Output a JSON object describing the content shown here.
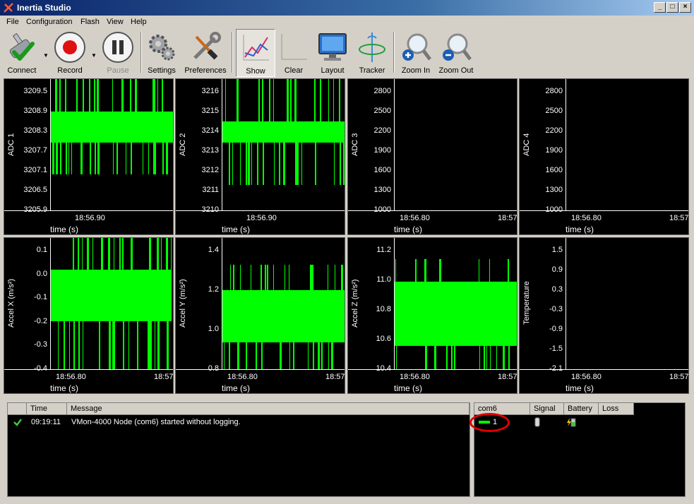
{
  "window": {
    "title": "Inertia Studio"
  },
  "menu": [
    "File",
    "Configuration",
    "Flash",
    "View",
    "Help"
  ],
  "toolbar": {
    "connect": "Connect",
    "record": "Record",
    "pause": "Pause",
    "settings": "Settings",
    "preferences": "Preferences",
    "show": "Show",
    "clear": "Clear",
    "layout": "Layout",
    "tracker": "Tracker",
    "zoom_in": "Zoom In",
    "zoom_out": "Zoom Out"
  },
  "plots": [
    {
      "ylabel": "ADC 1",
      "yticks": [
        "3209.5",
        "3208.9",
        "3208.3",
        "3207.7",
        "3207.1",
        "3206.5",
        "3205.9"
      ],
      "xticks": [
        "18:56.90"
      ],
      "xlabel": "time (s)"
    },
    {
      "ylabel": "ADC 2",
      "yticks": [
        "3216",
        "3215",
        "3214",
        "3213",
        "3212",
        "3211",
        "3210"
      ],
      "xticks": [
        "18:56.90"
      ],
      "xlabel": "time (s)"
    },
    {
      "ylabel": "ADC 3",
      "yticks": [
        "2800",
        "2500",
        "2200",
        "1900",
        "1600",
        "1300",
        "1000"
      ],
      "xticks": [
        "18:56.80",
        "18:57"
      ],
      "xlabel": "time (s)"
    },
    {
      "ylabel": "ADC 4",
      "yticks": [
        "2800",
        "2500",
        "2200",
        "1900",
        "1600",
        "1300",
        "1000"
      ],
      "xticks": [
        "18:56.80",
        "18:57"
      ],
      "xlabel": "time (s)"
    },
    {
      "ylabel": "Accel X (m/s²)",
      "yticks": [
        "0.1",
        "0.0",
        "-0.1",
        "-0.2",
        "-0.3",
        "-0.4"
      ],
      "xticks": [
        "18:56.80",
        "18:57"
      ],
      "xlabel": "time (s)"
    },
    {
      "ylabel": "Accel Y (m/s²)",
      "yticks": [
        "1.4",
        "1.2",
        "1.0",
        "0.8"
      ],
      "xticks": [
        "18:56.80",
        "18:57"
      ],
      "xlabel": "time (s)"
    },
    {
      "ylabel": "Accel Z (m/s²)",
      "yticks": [
        "11.2",
        "11.0",
        "10.8",
        "10.6",
        "10.4"
      ],
      "xticks": [
        "18:56.80",
        "18:57"
      ],
      "xlabel": "time (s)"
    },
    {
      "ylabel": "Temperature",
      "yticks": [
        "1.5",
        "0.9",
        "0.3",
        "-0.3",
        "-0.9",
        "-1.5",
        "-2.1"
      ],
      "xticks": [
        "18:56.80",
        "18:57"
      ],
      "xlabel": "time (s)"
    }
  ],
  "log": {
    "columns": [
      "Time",
      "Message"
    ],
    "rows": [
      {
        "time": "09:19:11",
        "message": "VMon-4000 Node (com6) started without logging."
      }
    ]
  },
  "nodes": {
    "columns": [
      "com6",
      "Signal",
      "Battery",
      "Loss"
    ],
    "rows": [
      {
        "id": "1"
      }
    ]
  },
  "colors": {
    "signal": "#00ff00",
    "highlight": "#e00000",
    "title_bar": "#0a246a"
  }
}
